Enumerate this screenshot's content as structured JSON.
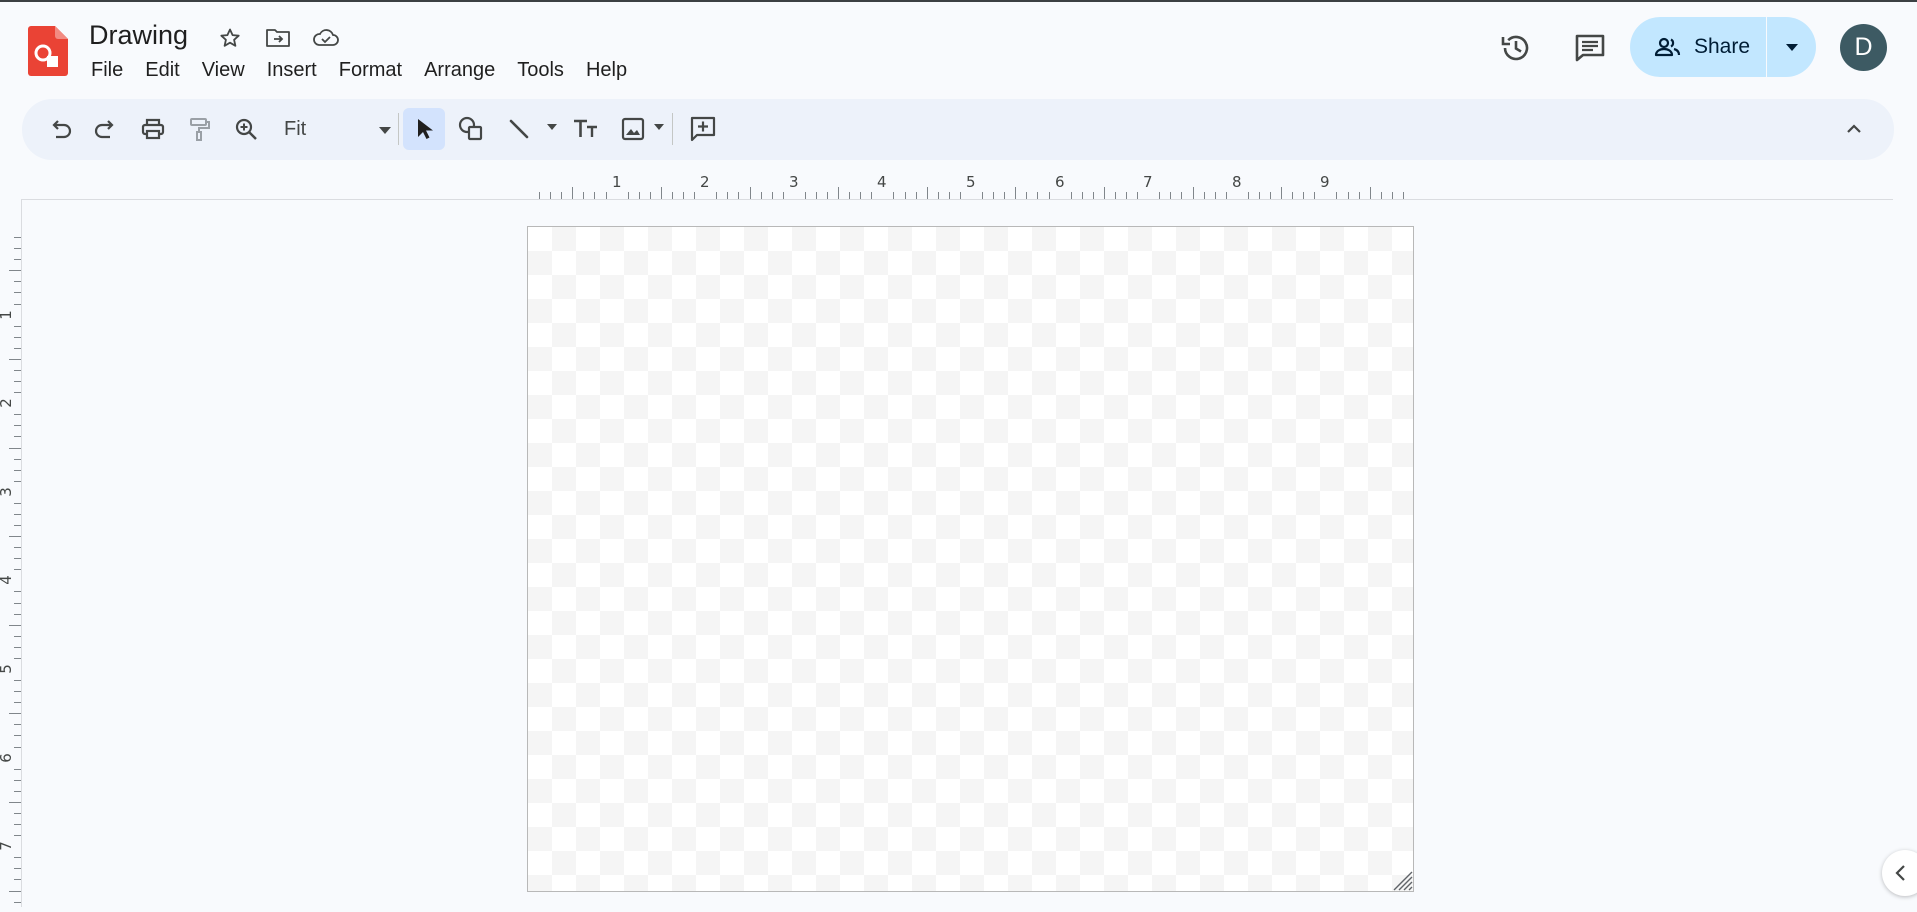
{
  "app": {
    "title": "Drawing",
    "brand_color": "#ea4335"
  },
  "title_icons": [
    "star-icon",
    "move-to-folder-icon",
    "cloud-saved-icon"
  ],
  "menu": [
    "File",
    "Edit",
    "View",
    "Insert",
    "Format",
    "Arrange",
    "Tools",
    "Help"
  ],
  "header": {
    "history_icon": "version-history-icon",
    "comments_icon": "comments-icon",
    "share_label": "Share",
    "share_color": "#c2e7ff",
    "avatar_letter": "D",
    "avatar_color": "#3d5a63"
  },
  "toolbar": {
    "zoom_value": "Fit",
    "buttons": [
      "undo-icon",
      "redo-icon",
      "print-icon",
      "paint-format-icon",
      "zoom-icon",
      "select-icon",
      "shape-icon",
      "line-icon",
      "text-box-icon",
      "image-icon",
      "add-comment-icon",
      "collapse-icon"
    ],
    "active_tool": "select"
  },
  "ruler": {
    "horizontal": [
      "1",
      "2",
      "3",
      "4",
      "5",
      "6",
      "7",
      "8",
      "9"
    ],
    "vertical": [
      "1",
      "2",
      "3",
      "4",
      "5",
      "6",
      "7"
    ]
  }
}
